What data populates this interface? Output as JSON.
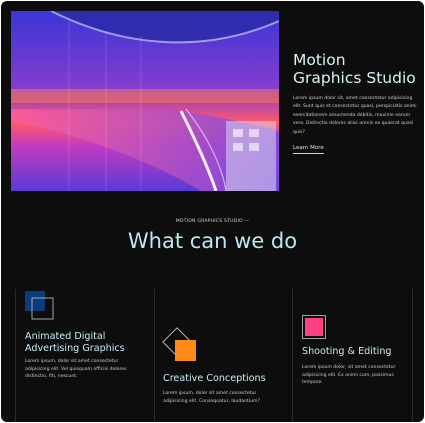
{
  "hero": {
    "title": "Motion Graphics Studio",
    "body": "Lorem ipsum dolor sit, amet consectetur adipisicing elit. Sunt quis et consectetur quasi, perspiciatis animi exercitationem assumenda debitis, maxime earum vero. Distinctio dolores alias omnis ex quaerat quasi quis?",
    "link_label": "Learn More",
    "image_icon": "purple-glass-walkway-photo"
  },
  "section": {
    "eyebrow": "MOTION GRAPHICS STUDIO —",
    "title": "What can we do"
  },
  "cards": [
    {
      "title": "Animated Digital Advertising Graphics",
      "text": "Lorem ipsum, dolor sit amet consectetur adipisicing elit. Vel quisquam officiis dolores distinctio, fiti, nescunt.",
      "icon": "overlapping-blue-squares-icon",
      "accent": "#0b3c7a"
    },
    {
      "title": "Creative Conceptions",
      "text": "Lorem ipsum, dolor sit amet consectetur adipisicing elit. Consequatur, laudantium?",
      "icon": "orange-square-with-diamond-icon",
      "accent": "#ff8a1c"
    },
    {
      "title": "Shooting & Editing",
      "text": "Lorem ipsum dolor, sit amet consectetur adipisicing elit. Ex animi cum, possimus tempore.",
      "icon": "pink-square-icon",
      "accent": "#ff3f86"
    }
  ],
  "colors": {
    "background": "#0d0d0e",
    "heading": "#bfe7f1",
    "text": "#cfcfcf"
  }
}
